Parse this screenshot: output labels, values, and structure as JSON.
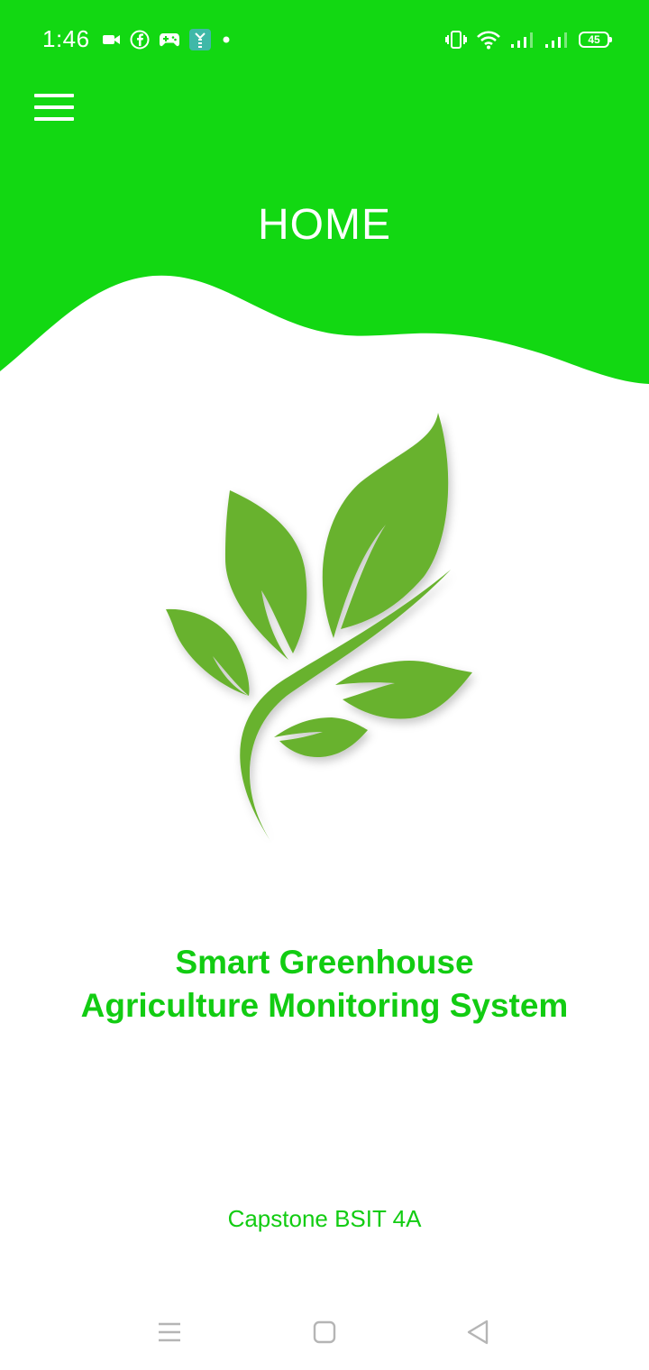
{
  "status_bar": {
    "time": "1:46",
    "battery_level": "45",
    "left_icons": [
      "video-camera-icon",
      "facebook-icon",
      "gamepad-icon",
      "app-notification-icon",
      "dot-icon"
    ],
    "right_icons": [
      "vibrate-icon",
      "wifi-icon",
      "signal-icon",
      "signal-icon"
    ]
  },
  "header": {
    "title": "HOME",
    "menu_icon": "hamburger-menu-icon",
    "background_color": "#12d812"
  },
  "main": {
    "logo_icon": "plant-leaves-logo-icon",
    "logo_color": "#68b22f",
    "title_line1": "Smart Greenhouse",
    "title_line2": "Agriculture Monitoring System",
    "credit": "Capstone BSIT 4A",
    "accent_color": "#12cc12"
  },
  "nav_bar": {
    "icons": [
      "recents-menu-icon",
      "home-square-icon",
      "back-triangle-icon"
    ]
  }
}
